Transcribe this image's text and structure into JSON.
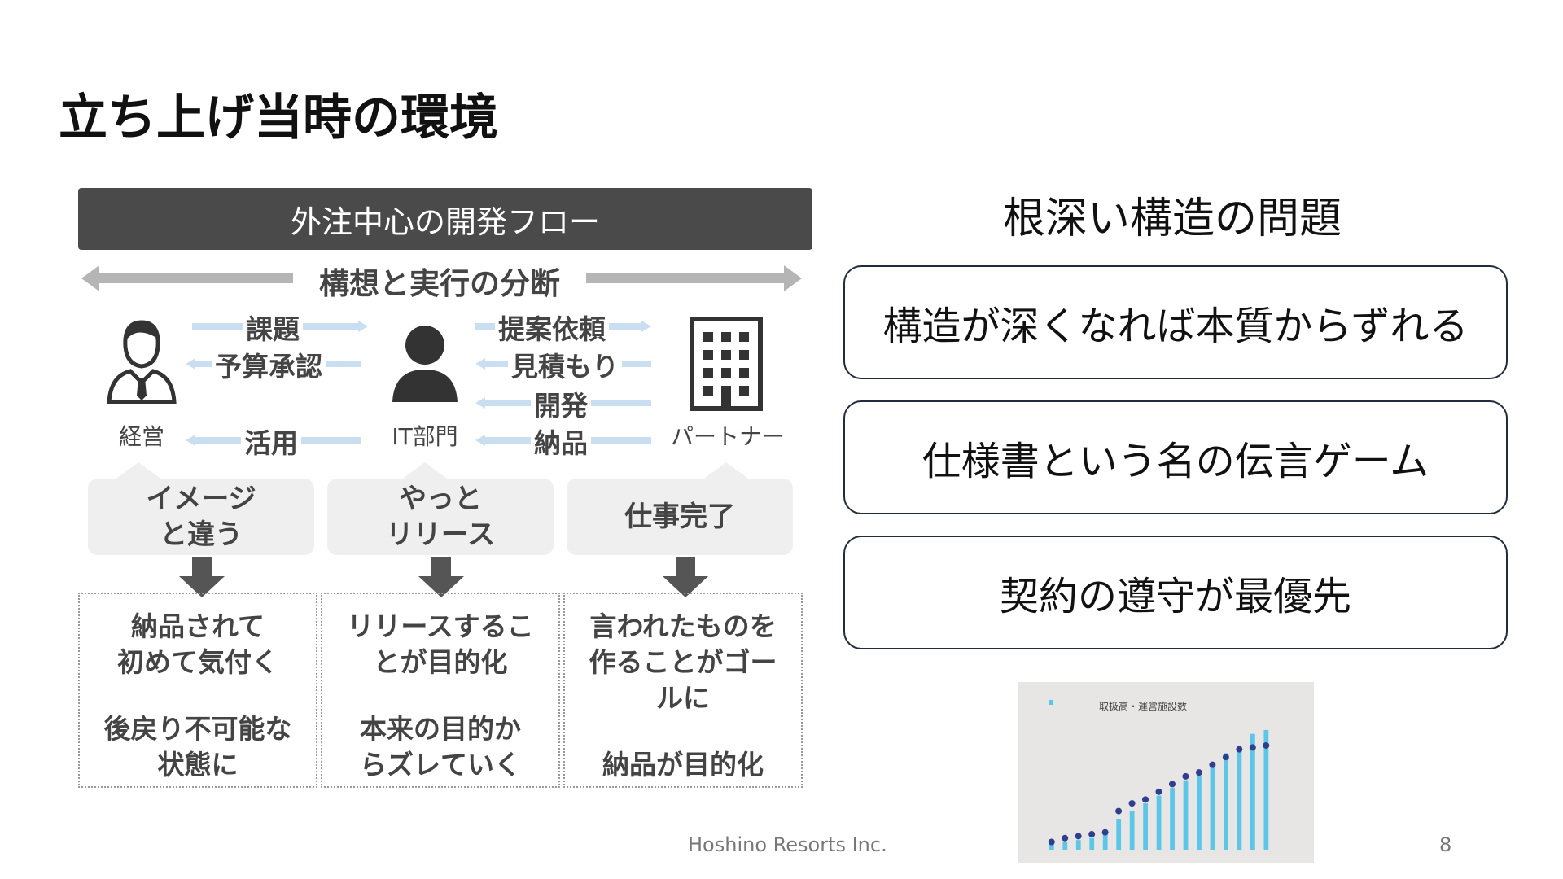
{
  "title": "立ち上げ当時の環境",
  "diagram": {
    "header": "外注中心の開発フロー",
    "split_label": "構想と実行の分断",
    "actors": {
      "management": "経営",
      "it": "IT部門",
      "partner": "パートナー"
    },
    "flows_left": [
      "課題",
      "予算承認",
      "活用"
    ],
    "flows_right": [
      "提案依頼",
      "見積もり",
      "開発",
      "納品"
    ],
    "bubbles": [
      [
        "イメージ",
        "と違う"
      ],
      [
        "やっと",
        "リリース"
      ],
      [
        "仕事完了"
      ]
    ],
    "results": [
      {
        "line1": "納品されて",
        "line2": "初めて気付く",
        "line3": "後戻り不可能な",
        "line4": "状態に"
      },
      {
        "line1": "リリースするこ",
        "line2": "とが目的化",
        "line3": "本来の目的か",
        "line4": "らズレていく"
      },
      {
        "line1": "言われたものを",
        "line2": "作ることがゴー",
        "line2b": "ルに",
        "line4": "納品が目的化"
      }
    ]
  },
  "right": {
    "heading": "根深い構造の問題",
    "problems": [
      "構造が深くなれば本質からずれる",
      "仕様書という名の伝言ゲーム",
      "契約の遵守が最優先"
    ]
  },
  "mini_chart": {
    "title": "取扱高・運営施設数",
    "bar_values": [
      1.5,
      2,
      2.5,
      3,
      4,
      8,
      10,
      12,
      14,
      16,
      18,
      19,
      22,
      25,
      27,
      30,
      31
    ],
    "dot_values": [
      2,
      3,
      3.5,
      4,
      4.5,
      10,
      12,
      13,
      15,
      17,
      19,
      20,
      22,
      24,
      26,
      26.5,
      27
    ],
    "colors": {
      "bar": "#5bc6e8",
      "dot": "#2e3f8f"
    }
  },
  "footer": {
    "company": "Hoshino Resorts Inc.",
    "page": "8"
  }
}
